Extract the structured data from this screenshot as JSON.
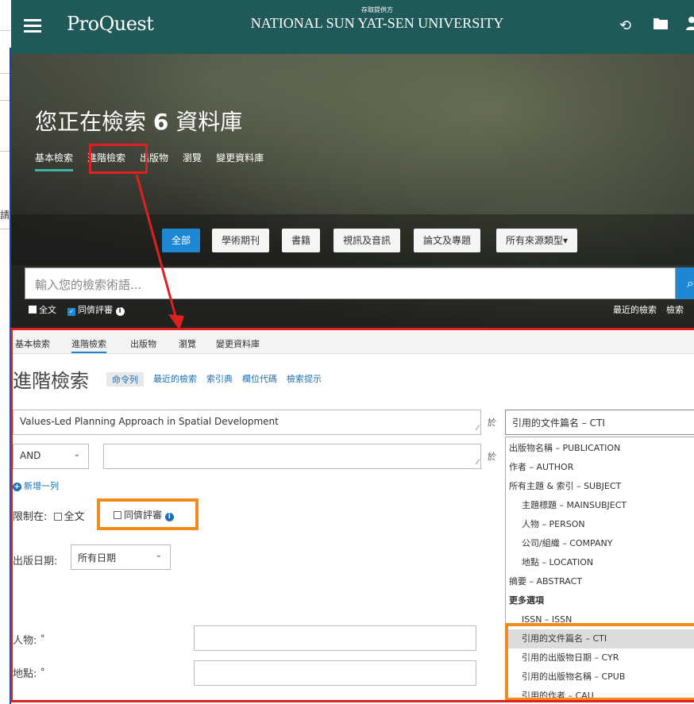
{
  "topbar": {
    "logo": "ProQuest",
    "provided_by": "存取提供方",
    "university": "NATIONAL SUN YAT-SEN UNIVERSITY",
    "icons": [
      "menu-icon",
      "history-icon",
      "folder-icon",
      "user-icon"
    ]
  },
  "left_partial_text": "請",
  "hero": {
    "title_prefix": "您正在檢索 ",
    "title_count": "6",
    "title_suffix": " 資料庫",
    "tabs": [
      "基本檢索",
      "進階檢索",
      "出版物",
      "瀏覽",
      "變更資料庫"
    ],
    "source_chips": [
      "全部",
      "學術期刊",
      "書籍",
      "視訊及音訊",
      "論文及專題",
      "所有來源類型▾"
    ],
    "search_placeholder": "輸入您的檢索術語...",
    "fulltext_label": "全文",
    "peer_label": "同儕評審",
    "recent_searches": "最近的檢索",
    "search_tips": "檢索"
  },
  "advanced": {
    "tabs": [
      "基本檢索",
      "進階檢索",
      "出版物",
      "瀏覽",
      "變更資料庫"
    ],
    "title": "進階檢索",
    "sublinks": [
      "命令列",
      "最近的檢索",
      "索引典",
      "欄位代碼",
      "檢索提示"
    ],
    "row1_value": "Values-Led Planning Approach in Spatial Development",
    "in_label": "於",
    "field_select_value": "引用的文件篇名 – CTI",
    "operator": "AND",
    "row2_value": "",
    "add_row": "新增一列",
    "limit_label": "限制在:",
    "limit_fulltext": "全文",
    "limit_peer": "同儕評審",
    "pub_date_label": "出版日期:",
    "pub_date_value": "所有日期",
    "person_label": "人物: ˚",
    "place_label": "地點: ˚"
  },
  "field_dropdown": {
    "items": [
      {
        "label": "出版物名稱 – PUBLICATION",
        "indent": false
      },
      {
        "label": "作者 – AUTHOR",
        "indent": false
      },
      {
        "label": "所有主題 & 索引 – SUBJECT",
        "indent": false
      },
      {
        "label": "主題標題 – MAINSUBJECT",
        "indent": true
      },
      {
        "label": "人物 – PERSON",
        "indent": true
      },
      {
        "label": "公司/組織 – COMPANY",
        "indent": true
      },
      {
        "label": "地點 – LOCATION",
        "indent": true
      },
      {
        "label": "摘要 – ABSTRACT",
        "indent": false
      },
      {
        "label": "更多選項",
        "indent": false,
        "bold": true
      },
      {
        "label": "ISSN – ISSN",
        "indent": true
      },
      {
        "label": "引用的文件篇名 – CTI",
        "indent": true,
        "selected": true
      },
      {
        "label": "引用的出版物日期 – CYR",
        "indent": true
      },
      {
        "label": "引用的出版物名稱 – CPUB",
        "indent": true
      },
      {
        "label": "引用的作者 – CAU",
        "indent": true
      }
    ]
  },
  "colors": {
    "topbar": "#1f5a58",
    "accent_blue": "#1e88d4",
    "annotation_red": "#e02020",
    "annotation_orange": "#f28a1e"
  }
}
